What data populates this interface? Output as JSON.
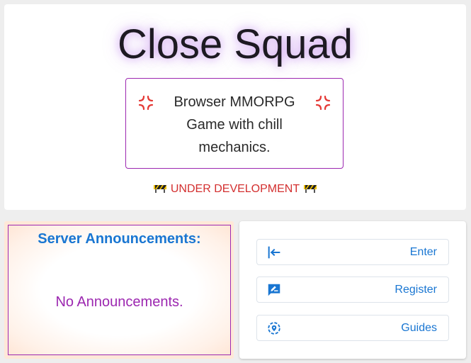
{
  "hero": {
    "title": "Close Squad",
    "tagline": "Browser MMORPG Game with chill mechanics.",
    "tagline_icon": "anger-symbol-icon",
    "dev_notice": "UNDER DEVELOPMENT",
    "dev_icon": "construction-barrier-icon"
  },
  "announcements": {
    "title": "Server Announcements:",
    "empty_text": "No Announcements."
  },
  "menu": {
    "enter_label": "Enter",
    "register_label": "Register",
    "guides_label": "Guides",
    "enter_icon": "login-icon",
    "register_icon": "rate-review-icon",
    "guides_icon": "location-explore-icon"
  },
  "colors": {
    "primary": "#1976d2",
    "secondary": "#9c27b0",
    "warning": "#d32f2f",
    "anger": "#e53935"
  }
}
